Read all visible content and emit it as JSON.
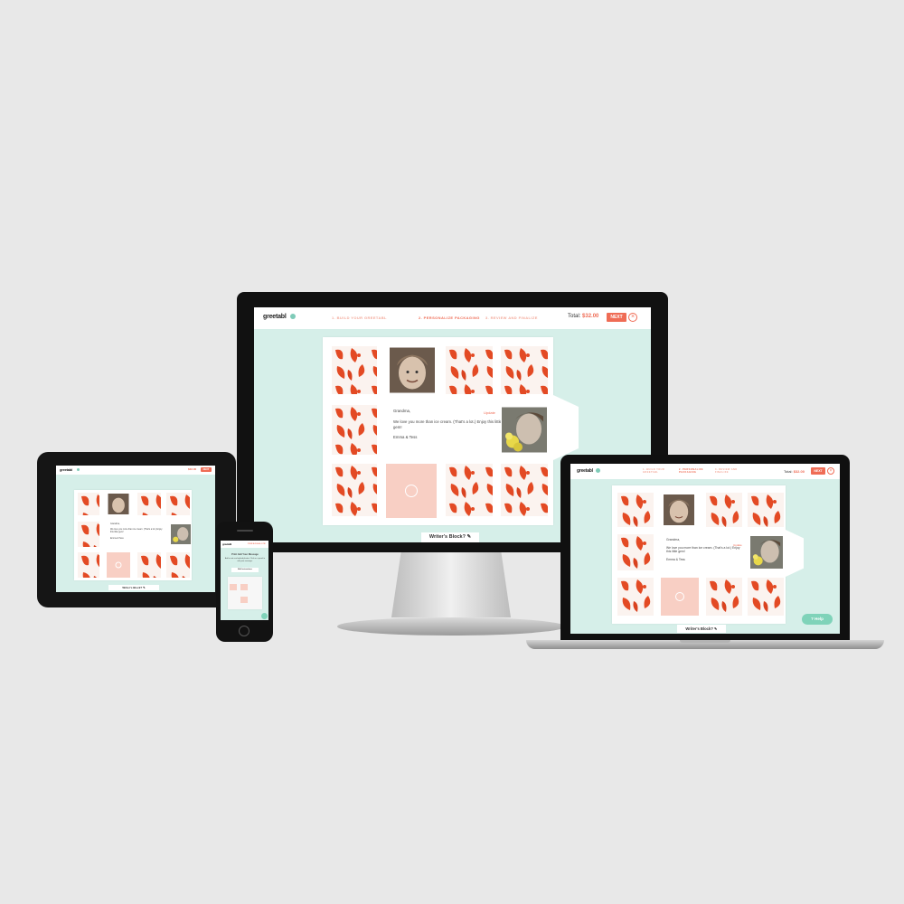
{
  "app": {
    "logo": "greetabl",
    "steps": [
      "1. BUILD YOUR GREETABL",
      "2. PERSONALIZE PACKAGING",
      "3. REVIEW AND FINALIZE"
    ],
    "total_label": "Total:",
    "total_value": "$32.00",
    "next_label": "NEXT",
    "close_icon": "×",
    "writers_block": "Writer's Block? ✎",
    "help_label": "Help",
    "update_label": "Update"
  },
  "message": {
    "greeting": "Grandma,",
    "body": "We love you more than ice cream. (That's a lot.) Enjoy this little gem!",
    "signature": "Emma & Tess"
  },
  "phone": {
    "top_label": "PERSONALIZE",
    "headline": "Print Add Your Message",
    "subline": "Add a note and upload photos. Click on a panel to edit your message.",
    "button": "Edit Instructions"
  },
  "colors": {
    "accent": "#ef6c55",
    "mint": "#d6efe9",
    "help": "#7fd3b9",
    "pattern": "#e34a24"
  }
}
